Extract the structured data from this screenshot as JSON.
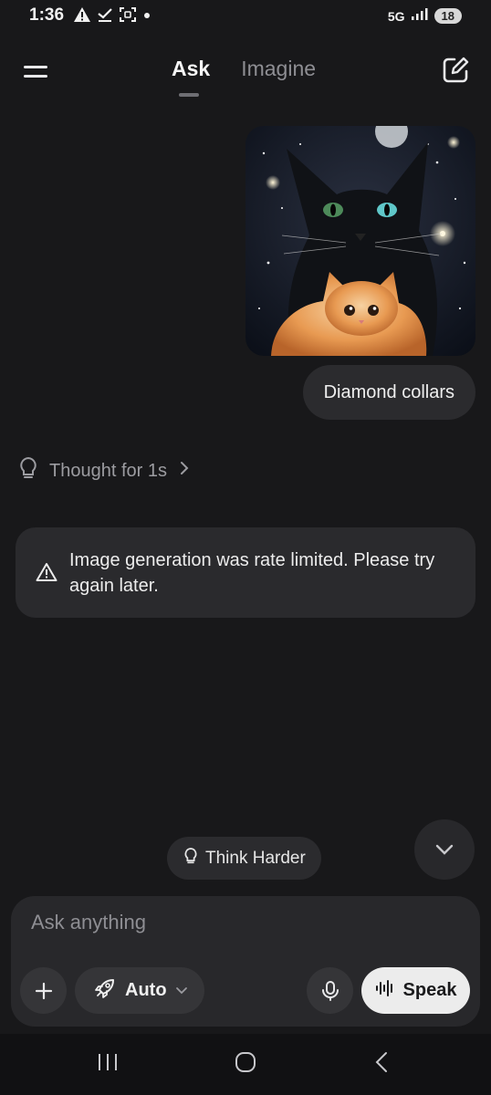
{
  "status_bar": {
    "time": "1:36",
    "network": "5G",
    "battery": "18",
    "left_icons": [
      "warning-icon",
      "download-done-icon",
      "screenshot-icon",
      "dot-icon"
    ],
    "right_icons": [
      "signal-icon"
    ]
  },
  "header": {
    "tabs": [
      {
        "label": "Ask",
        "active": true
      },
      {
        "label": "Imagine",
        "active": false
      }
    ],
    "menu_icon": "menu-icon",
    "new_chat_icon": "edit-icon"
  },
  "conversation": {
    "user_image": {
      "subject": "black cat with orange kitten in starry night sky"
    },
    "user_message": "Diamond collars",
    "thought": {
      "label": "Thought for 1s",
      "icon": "lightbulb-icon"
    },
    "error": {
      "icon": "warning-icon",
      "text": "Image generation was rate limited. Please try again later."
    }
  },
  "suggestion": {
    "label": "Think Harder",
    "icon": "lightbulb-icon"
  },
  "composer": {
    "placeholder": "Ask anything",
    "value": "",
    "mode_label": "Auto",
    "speak_label": "Speak"
  },
  "colors": {
    "background": "#18181a",
    "surface": "#2a2a2d",
    "speak_button": "#ececec"
  }
}
